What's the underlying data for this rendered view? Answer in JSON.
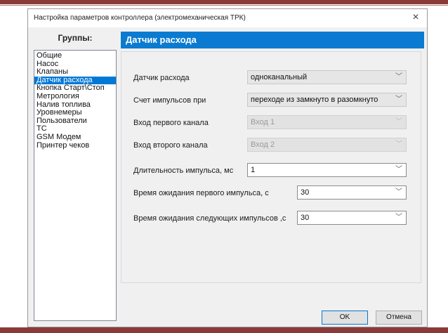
{
  "window": {
    "title": "Настройка параметров контроллера (электромеханическая ТРК)",
    "close_label": "×"
  },
  "sidebar": {
    "heading": "Группы:",
    "items": [
      {
        "label": "Общие"
      },
      {
        "label": "Насос"
      },
      {
        "label": "Клапаны"
      },
      {
        "label": "Датчик расхода",
        "selected": true
      },
      {
        "label": "Кнопка Старт\\Стоп"
      },
      {
        "label": "Метрология"
      },
      {
        "label": "Налив топлива"
      },
      {
        "label": "Уровнемеры"
      },
      {
        "label": "Пользователи"
      },
      {
        "label": "ТС"
      },
      {
        "label": "GSM Модем"
      },
      {
        "label": "Принтер чеков"
      }
    ]
  },
  "panel": {
    "title": "Датчик расхода",
    "fields": {
      "sensor": {
        "label": "Датчик расхода",
        "value": "одноканальный"
      },
      "count": {
        "label": "Счет импульсов при",
        "value": "переходе из замкнуто в разомкнуто"
      },
      "input1": {
        "label": "Вход первого канала",
        "value": "Вход 1"
      },
      "input2": {
        "label": "Вход второго канала",
        "value": "Вход 2"
      },
      "pulse_duration": {
        "label": "Длительность импульса, мс",
        "value": "1"
      },
      "first_wait": {
        "label": "Время ожидания первого импульса, с",
        "value": "30"
      },
      "next_wait": {
        "label": "Время ожидания следующих импульсов ,с",
        "value": "30"
      }
    }
  },
  "buttons": {
    "ok": "OK",
    "cancel": "Отмена"
  },
  "icons": {
    "dropdown": "chevron-down-icon",
    "close": "close-icon"
  },
  "colors": {
    "accent": "#0a7bd1",
    "selection": "#0078d7",
    "decor": "#8b3a3a"
  }
}
